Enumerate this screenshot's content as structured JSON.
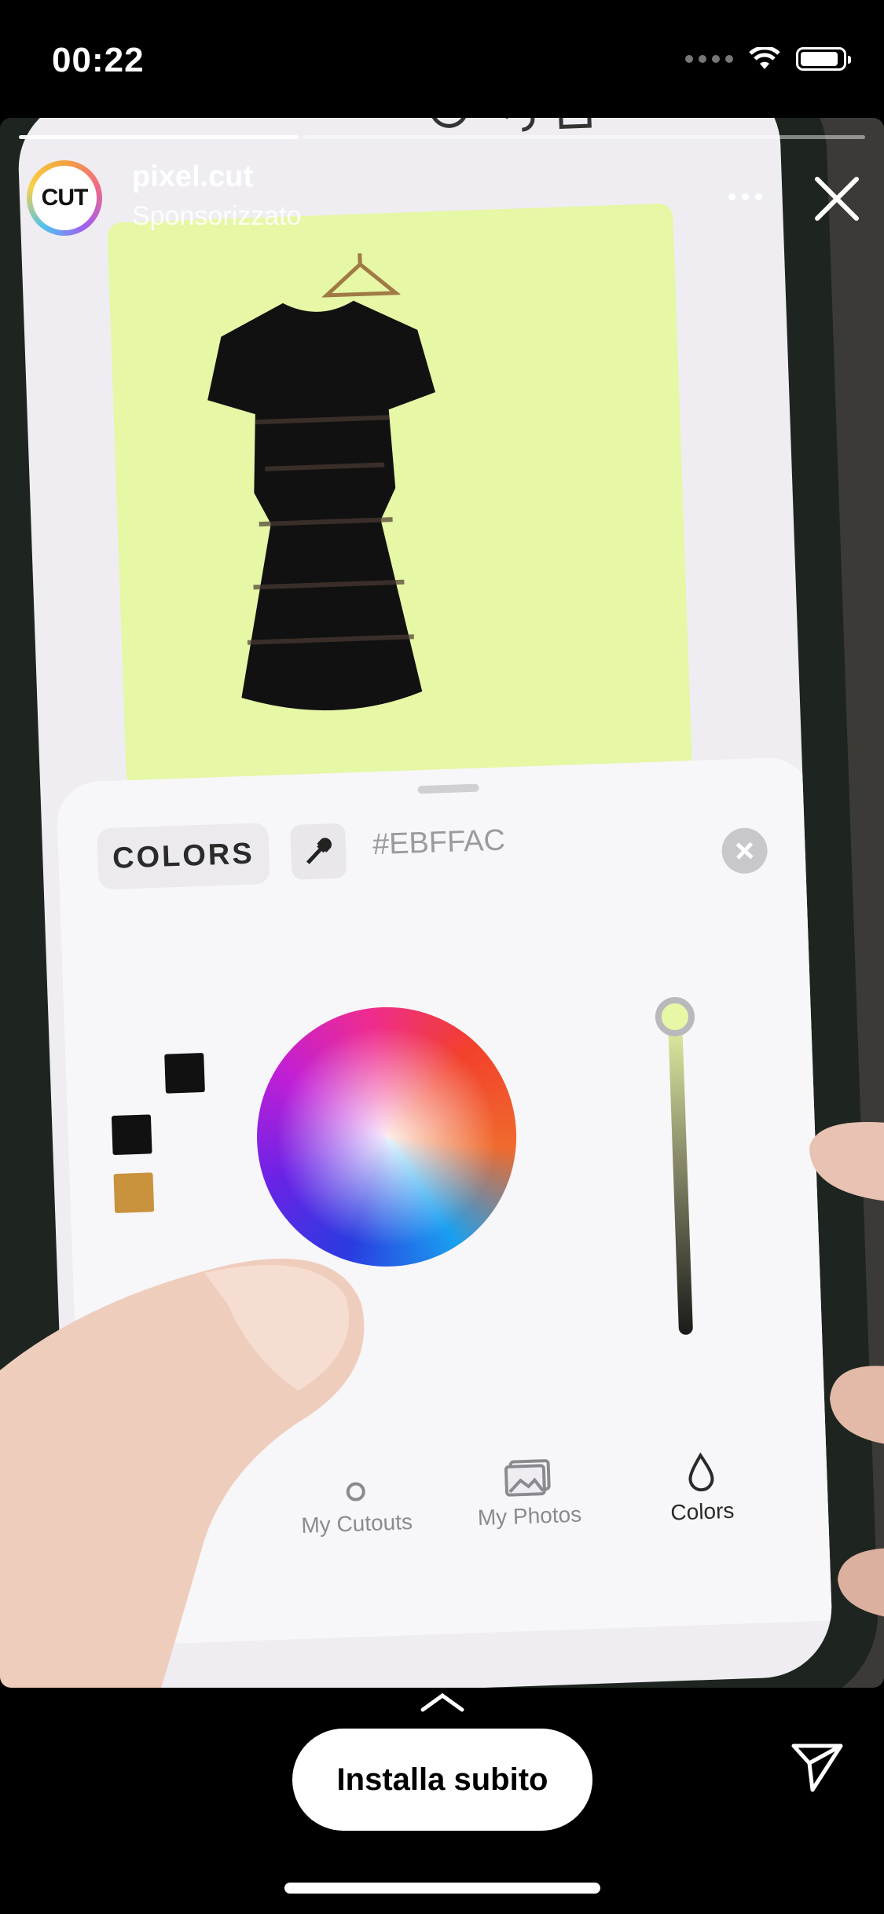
{
  "status_bar": {
    "time": "00:22",
    "icons": [
      "signal-dots-icon",
      "wifi-icon",
      "battery-icon"
    ]
  },
  "story": {
    "account_name": "pixel.cut",
    "sponsored_label": "Sponsorizzato",
    "avatar_text": "CUT",
    "progress_segments": 2,
    "active_segment": 1
  },
  "video": {
    "sheet_title": "COLORS",
    "hex_value": "#EBFFAC",
    "canvas_background": "#EBFFAC",
    "tabs": [
      {
        "label": "My Cutouts",
        "icon": "cutouts-icon",
        "active": false
      },
      {
        "label": "My Photos",
        "icon": "photos-icon",
        "active": false
      },
      {
        "label": "Colors",
        "icon": "drop-icon",
        "active": true
      }
    ],
    "toolbar_icons": [
      "dots-icon",
      "target-icon",
      "undo-icon",
      "share-icon"
    ]
  },
  "cta": {
    "install_label": "Installa subito"
  },
  "colors": {
    "background": "#000000",
    "accent": "#FFFFFF"
  }
}
